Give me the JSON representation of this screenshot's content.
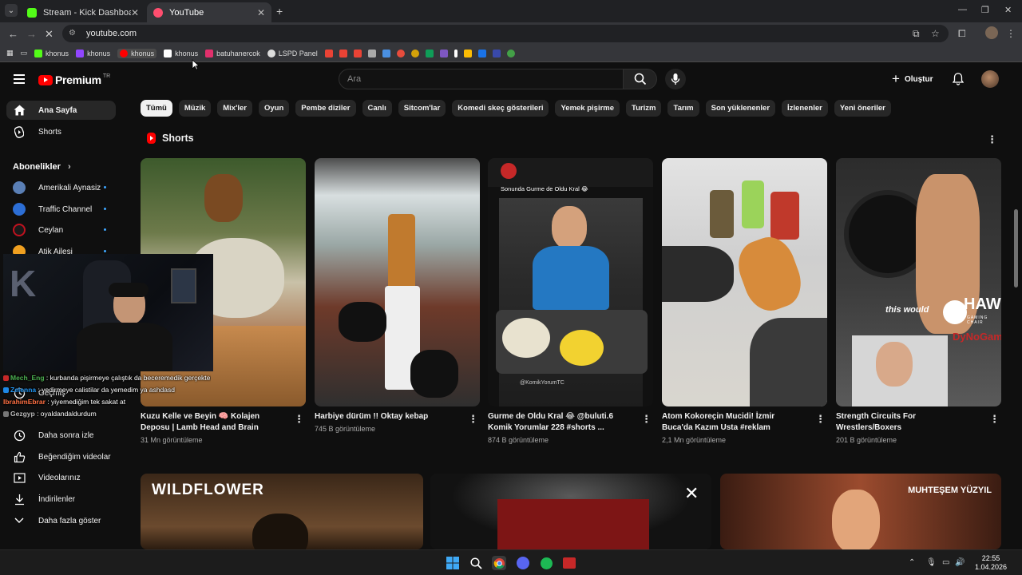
{
  "browser": {
    "tabs": [
      {
        "title": "Stream - Kick Dashboard",
        "favicon_color": "#53fc18",
        "active": false
      },
      {
        "title": "YouTube",
        "favicon_color": "#ff4e6f",
        "active": true
      }
    ],
    "url": "youtube.com",
    "bookmarks": [
      {
        "label": "khonus",
        "icon_color": "#53fc18"
      },
      {
        "label": "khonus",
        "icon_color": "#9146ff"
      },
      {
        "label": "khonus",
        "icon_color": "#ff0000"
      },
      {
        "label": "khonus",
        "icon_color": "#ffffff"
      },
      {
        "label": "batuhanercok",
        "icon_color": "#e1306c"
      },
      {
        "label": "LSPD Panel",
        "icon_color": "#dddddd"
      }
    ]
  },
  "yt": {
    "logo_text": "Premium",
    "logo_badge": "TR",
    "search_placeholder": "Ara",
    "create_label": "Oluştur"
  },
  "sidebar": {
    "home": "Ana Sayfa",
    "shorts": "Shorts",
    "subscriptions_heading": "Abonelikler",
    "channels": [
      {
        "name": "Amerikali Aynasiz",
        "color": "#5a7fb5"
      },
      {
        "name": "Traffic Channel",
        "color": "#2c6ed5"
      },
      {
        "name": "Ceylan",
        "color": "#c1121f"
      },
      {
        "name": "Atik Ailesi",
        "color": "#f0a020"
      }
    ],
    "history": "Geçmiş",
    "watch_later": "Daha sonra izle",
    "liked": "Beğendiğim videolar",
    "your_videos": "Videolarınız",
    "downloads": "İndirilenler",
    "show_more": "Daha fazla göster"
  },
  "chips": [
    "Tümü",
    "Müzik",
    "Mix'ler",
    "Oyun",
    "Pembe diziler",
    "Canlı",
    "Sitcom'lar",
    "Komedi skeç gösterileri",
    "Yemek pişirme",
    "Turizm",
    "Tarım",
    "Son yüklenenler",
    "İzlenenler",
    "Yeni öneriler"
  ],
  "shorts_section": {
    "title": "Shorts",
    "items": [
      {
        "title": "Kuzu Kelle ve Beyin 🧠 Kolajen Deposu | Lamb Head and Brain",
        "views": "31 Mn görüntüleme"
      },
      {
        "title": "Harbiye dürüm !! Oktay kebap",
        "views": "745 B görüntüleme"
      },
      {
        "title": "Gurme de Oldu Kral 😂 @buluti.6 Komik Yorumlar 228 #shorts ...",
        "views": "874 B görüntüleme",
        "overlay": "Sonunda Gurme de Oldu Kral 😂",
        "watermark": "@KomikYorumTC"
      },
      {
        "title": "Atom Kokoreçin Mucidi! İzmir Buca'da Kazım Usta #reklam",
        "views": "2,1 Mn görüntüleme"
      },
      {
        "title": "Strength Circuits For Wrestlers/Boxers",
        "views": "201 B görüntüleme",
        "overlay": "this would",
        "brand": "HAWK",
        "brand_sub": "GAMING CHAIR",
        "brand2": "DyNoGame"
      }
    ]
  },
  "videos": [
    {
      "thumb_text": "WILDFLOWER"
    },
    {
      "thumb_text": ""
    },
    {
      "thumb_text": "MUHTEŞEM YÜZYIL"
    }
  ],
  "chat": [
    {
      "user": "Mech_Eng",
      "color": "#4caf50",
      "message": "kurbanda pişirmeye çalıştık da beceremedik gerçekten"
    },
    {
      "user": "Zelenna",
      "color": "#2196f3",
      "message": "yedirmeye calistilar da yemedim ya ashdasd"
    },
    {
      "user": "IbrahimEbrar",
      "color": "#ff7043",
      "message": "yiyemediğim tek sakat at"
    },
    {
      "user": "Gezgyp",
      "color": "#bbbbbb",
      "message": "oyaldandaldurdum"
    }
  ],
  "taskbar": {
    "time": "22:55",
    "date": "1.04.2026"
  }
}
